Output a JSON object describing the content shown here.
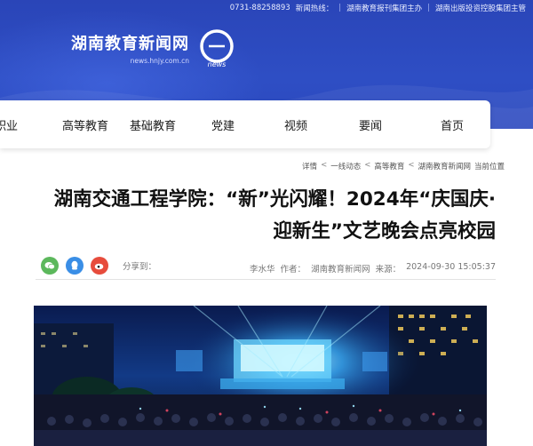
{
  "topbar": {
    "left": "湖南出版投资控股集团主管",
    "mid": "湖南教育报刊集团主办",
    "phone_label": "新闻热线：",
    "phone": "0731-88258893"
  },
  "logo": {
    "cn": "湖南教育新闻网",
    "en": "news.hnjy.com.cn",
    "mark_text": "news"
  },
  "nav": {
    "items": [
      "首页",
      "要闻",
      "视频",
      "党建",
      "基础教育",
      "高等教育",
      "职业"
    ]
  },
  "breadcrumb": {
    "label": "当前位置",
    "items": [
      "湖南教育新闻网",
      "高等教育",
      "一线动态",
      "详情"
    ]
  },
  "article": {
    "title": "湖南交通工程学院：“新”光闪耀！2024年“庆国庆·迎新生”文艺晚会点亮校园",
    "date": "2024-09-30 15:05:37",
    "source_label": "来源：",
    "source": "湖南教育新闻网",
    "author_label": "作者：",
    "author": "李水华",
    "share_label": "分享到："
  },
  "colors": {
    "banner": "#2e4ec4",
    "weibo": "#e74c3c",
    "qq": "#3a8ee6",
    "wechat": "#5cb85c"
  },
  "icons": [
    "weibo-icon",
    "qq-icon",
    "wechat-icon"
  ]
}
